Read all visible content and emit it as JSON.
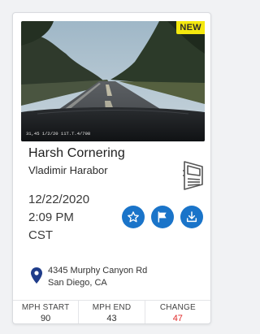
{
  "card": {
    "badge": "NEW",
    "thumbnail": {
      "overlay_text": "31,45 1/2/20 11T.T.4/798"
    },
    "event_title": "Harsh Cornering",
    "driver_name": "Vladimir Harabor",
    "date": "12/22/2020",
    "time": "2:09 PM",
    "timezone": "CST",
    "vehicle_icon": "truck-icon",
    "actions": [
      {
        "icon": "star-icon"
      },
      {
        "icon": "flag-icon"
      },
      {
        "icon": "download-icon"
      }
    ],
    "location": {
      "icon": "location-pin-icon",
      "line1": "4345 Murphy Canyon Rd",
      "line2": "San Diego, CA"
    },
    "stats": [
      {
        "label": "MPH START",
        "value": "90"
      },
      {
        "label": "MPH END",
        "value": "43"
      },
      {
        "label": "CHANGE",
        "value": "47"
      }
    ],
    "colors": {
      "accent": "#1a74c9",
      "badge": "#f4e80e",
      "change": "#e02a2a"
    }
  }
}
